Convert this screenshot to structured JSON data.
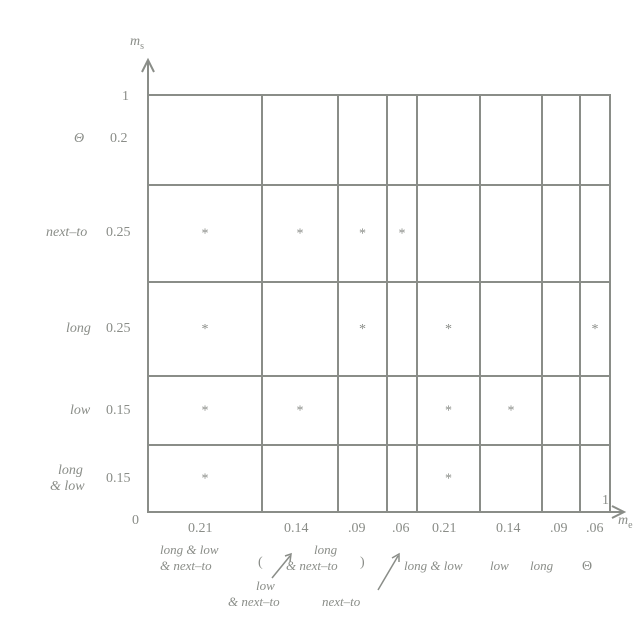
{
  "chart_data": {
    "type": "table",
    "title": "",
    "y_axis_label": "m_s",
    "x_axis_label": "m_e",
    "y_origin_label": "0",
    "y_top_label": "1",
    "x_right_label": "1",
    "theta_label": "Θ",
    "rows": [
      {
        "label": "Θ",
        "y_value": 0.2,
        "cells": [
          false,
          false,
          false,
          false,
          false,
          false,
          false,
          false
        ]
      },
      {
        "label": "next-to",
        "y_value": 0.25,
        "cells": [
          true,
          true,
          true,
          true,
          false,
          false,
          false,
          false
        ]
      },
      {
        "label": "long",
        "y_value": 0.25,
        "cells": [
          true,
          false,
          true,
          false,
          true,
          false,
          false,
          true
        ]
      },
      {
        "label": "low",
        "y_value": 0.15,
        "cells": [
          true,
          true,
          false,
          false,
          true,
          true,
          false,
          false
        ]
      },
      {
        "label": "long & low",
        "y_value": 0.15,
        "cells": [
          true,
          false,
          false,
          false,
          true,
          false,
          false,
          false
        ]
      }
    ],
    "row_y_values": [
      "0.2",
      "0.25",
      "0.25",
      "0.15",
      "0.15"
    ],
    "column_x_values": [
      "0.21",
      "0.14",
      ".09",
      ".06",
      "0.21",
      "0.14",
      ".09",
      ".06"
    ],
    "column_labels": [
      "long & low & next-to",
      "low & next-to",
      "long & next-to",
      "next-to",
      "long & low",
      "low",
      "long",
      "Θ"
    ],
    "row_boundaries": [
      95,
      185,
      282,
      376,
      445,
      512
    ],
    "column_boundaries": [
      148,
      262,
      338,
      387,
      417,
      480,
      542,
      580,
      610
    ],
    "xlim": [
      0,
      1
    ],
    "ylim": [
      0,
      1
    ]
  }
}
